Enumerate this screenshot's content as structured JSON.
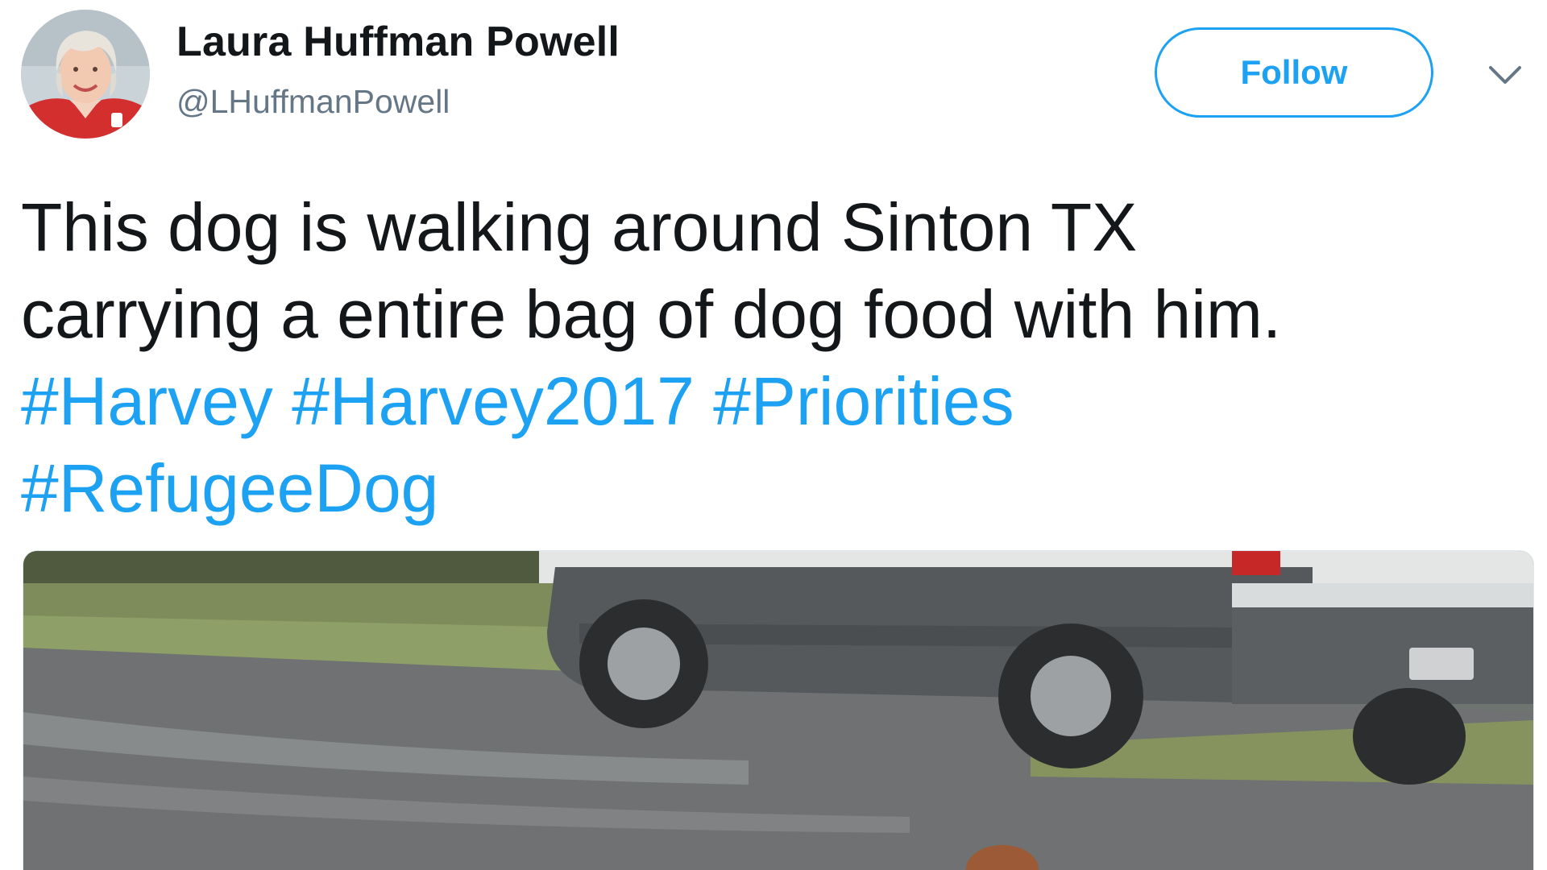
{
  "author": {
    "name": "Laura Huffman Powell",
    "handle": "@LHuffmanPowell",
    "avatar_icon": "profile-photo"
  },
  "actions": {
    "follow_label": "Follow",
    "more_icon": "chevron-down-icon"
  },
  "tweet": {
    "text_line_1": "This dog is walking around Sinton TX",
    "text_line_2": "carrying a entire bag of dog food with him.",
    "hashtags": [
      "#Harvey",
      "#Harvey2017",
      "#Priorities",
      "#RefugeeDog"
    ]
  },
  "colors": {
    "link": "#1da1f2",
    "text": "#14171a",
    "secondary": "#657786"
  }
}
